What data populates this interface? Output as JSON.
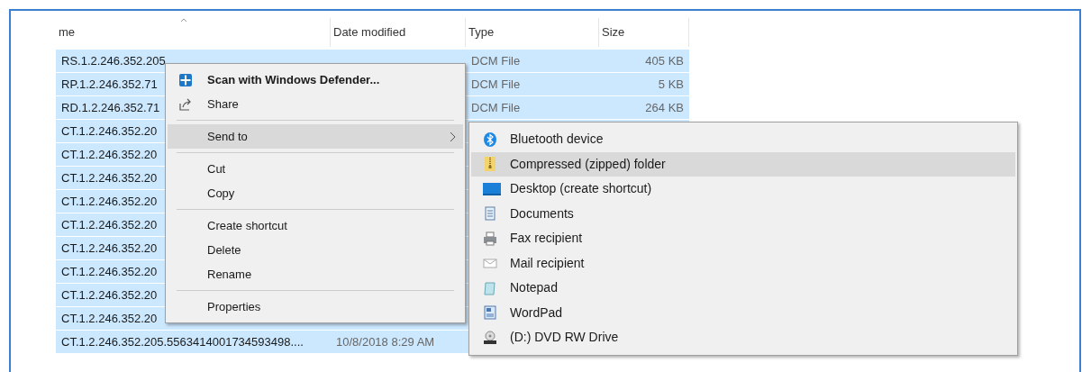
{
  "columns": [
    {
      "label": "me"
    },
    {
      "label": "Date modified"
    },
    {
      "label": "Type"
    },
    {
      "label": "Size"
    }
  ],
  "rows": [
    {
      "name": "RS.1.2.246.352.205",
      "type": "DCM File",
      "size": "405 KB",
      "selected": true
    },
    {
      "name": "RP.1.2.246.352.71",
      "type": "DCM File",
      "size": "5 KB",
      "selected": true
    },
    {
      "name": "RD.1.2.246.352.71",
      "type": "DCM File",
      "size": "264 KB",
      "selected": true
    },
    {
      "name": "CT.1.2.246.352.20",
      "selected": true
    },
    {
      "name": "CT.1.2.246.352.20",
      "selected": true
    },
    {
      "name": "CT.1.2.246.352.20",
      "selected": true
    },
    {
      "name": "CT.1.2.246.352.20",
      "selected": true
    },
    {
      "name": "CT.1.2.246.352.20",
      "selected": true
    },
    {
      "name": "CT.1.2.246.352.20",
      "selected": true
    },
    {
      "name": "CT.1.2.246.352.20",
      "selected": true
    },
    {
      "name": "CT.1.2.246.352.20",
      "selected": true
    },
    {
      "name": "CT.1.2.246.352.20",
      "selected": true
    },
    {
      "name": "CT.1.2.246.352.205.5563414001734593498....",
      "date": "10/8/2018 8:29 AM",
      "selected": true
    }
  ],
  "context_menu": {
    "items": [
      {
        "kind": "item",
        "label": "Scan with Windows Defender...",
        "bold": true,
        "selected": false
      },
      {
        "kind": "item",
        "label": "Share",
        "selected": false
      },
      {
        "kind": "separator"
      },
      {
        "kind": "item",
        "label": "Send to",
        "selected": true,
        "submenu": true
      },
      {
        "kind": "separator"
      },
      {
        "kind": "item",
        "label": "Cut",
        "selected": false
      },
      {
        "kind": "item",
        "label": "Copy",
        "selected": false
      },
      {
        "kind": "separator"
      },
      {
        "kind": "item",
        "label": "Create shortcut",
        "selected": false
      },
      {
        "kind": "item",
        "label": "Delete",
        "selected": false
      },
      {
        "kind": "item",
        "label": "Rename",
        "selected": false
      },
      {
        "kind": "separator"
      },
      {
        "kind": "item",
        "label": "Properties",
        "selected": false
      }
    ]
  },
  "send_to_menu": {
    "items": [
      {
        "label": "Bluetooth device",
        "selected": false
      },
      {
        "label": "Compressed (zipped) folder",
        "selected": true
      },
      {
        "label": "Desktop (create shortcut)",
        "selected": false
      },
      {
        "label": "Documents",
        "selected": false
      },
      {
        "label": "Fax recipient",
        "selected": false
      },
      {
        "label": "Mail recipient",
        "selected": false
      },
      {
        "label": "Notepad",
        "selected": false
      },
      {
        "label": "WordPad",
        "selected": false
      },
      {
        "label": "(D:) DVD RW Drive",
        "selected": false
      }
    ]
  }
}
